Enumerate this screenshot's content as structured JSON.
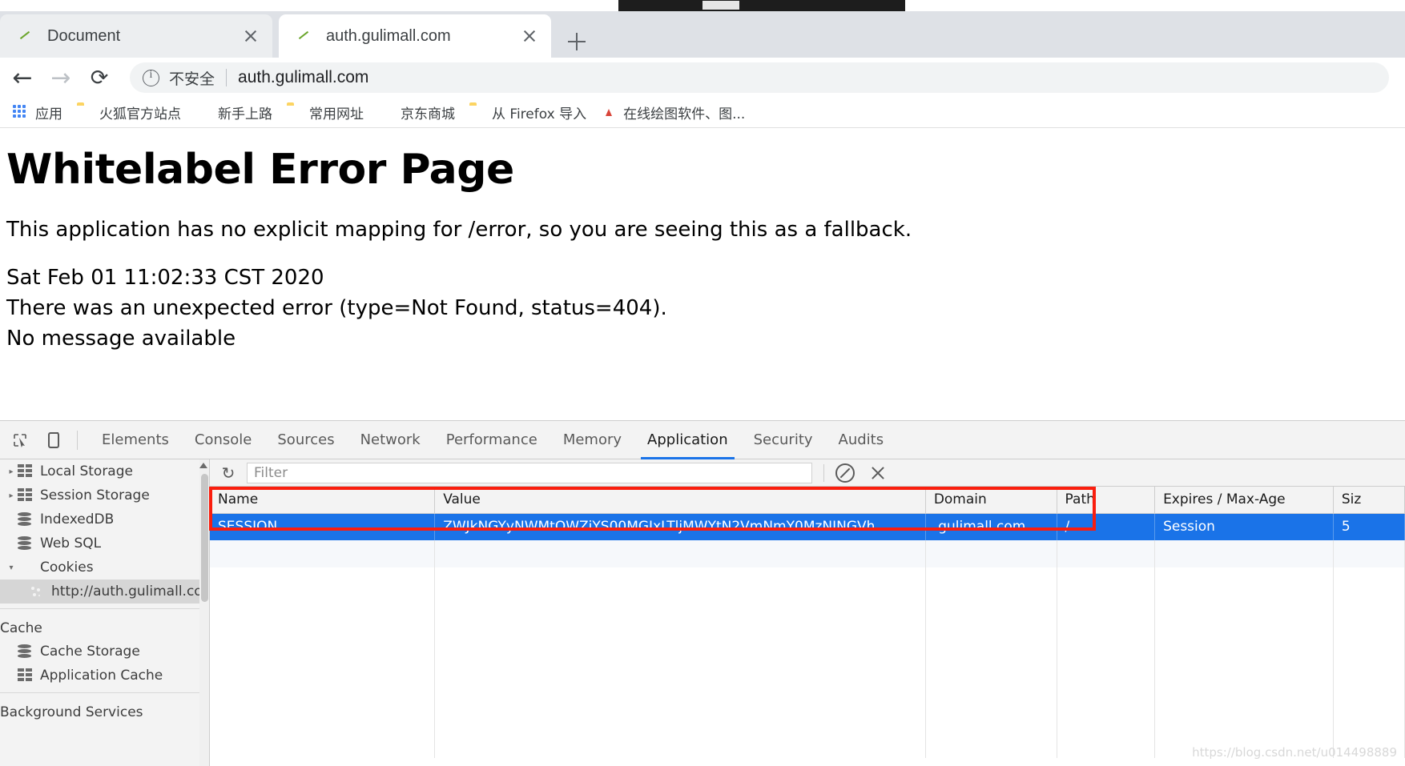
{
  "browser": {
    "tabs": [
      {
        "title": "Document",
        "favicon": "leaf-icon",
        "active": false
      },
      {
        "title": "auth.gulimall.com",
        "favicon": "leaf-icon",
        "active": true
      }
    ],
    "newtab_label": "+",
    "toolbar": {
      "back": "←",
      "forward": "→",
      "reload": "⟳",
      "security_label": "不安全",
      "url": "auth.gulimall.com"
    },
    "bookmarks": [
      {
        "label": "应用",
        "icon": "apps-grid-icon"
      },
      {
        "label": "火狐官方站点",
        "icon": "folder-icon"
      },
      {
        "label": "新手上路",
        "icon": "firefox-icon"
      },
      {
        "label": "常用网址",
        "icon": "folder-icon"
      },
      {
        "label": "京东商城",
        "icon": "globe-icon"
      },
      {
        "label": "从 Firefox 导入",
        "icon": "folder-icon"
      },
      {
        "label": "在线绘图软件、图...",
        "icon": "draw-icon"
      }
    ]
  },
  "page": {
    "heading": "Whitelabel Error Page",
    "paragraph": "This application has no explicit mapping for /error, so you are seeing this as a fallback.",
    "timestamp": "Sat Feb 01 11:02:33 CST 2020",
    "error_line": "There was an unexpected error (type=Not Found, status=404).",
    "message_line": "No message available"
  },
  "devtools": {
    "inspect_icon": "inspect-cursor-icon",
    "device_icon": "device-toolbar-icon",
    "tabs": [
      {
        "label": "Elements",
        "active": false
      },
      {
        "label": "Console",
        "active": false
      },
      {
        "label": "Sources",
        "active": false
      },
      {
        "label": "Network",
        "active": false
      },
      {
        "label": "Performance",
        "active": false
      },
      {
        "label": "Memory",
        "active": false
      },
      {
        "label": "Application",
        "active": true
      },
      {
        "label": "Security",
        "active": false
      },
      {
        "label": "Audits",
        "active": false
      }
    ],
    "sidebar": {
      "items": [
        {
          "label": "Local Storage",
          "icon": "grid-icon",
          "twisty": "▸",
          "indent": 0,
          "selected": false
        },
        {
          "label": "Session Storage",
          "icon": "grid-icon",
          "twisty": "▸",
          "indent": 0,
          "selected": false
        },
        {
          "label": "IndexedDB",
          "icon": "database-icon",
          "twisty": "",
          "indent": 1,
          "selected": false
        },
        {
          "label": "Web SQL",
          "icon": "database-icon",
          "twisty": "",
          "indent": 1,
          "selected": false
        },
        {
          "label": "Cookies",
          "icon": "cookie-icon",
          "twisty": "▾",
          "indent": 0,
          "selected": false
        },
        {
          "label": "http://auth.gulimall.com",
          "icon": "cookie-icon",
          "twisty": "",
          "indent": 2,
          "selected": true
        }
      ],
      "cache_section_title": "Cache",
      "cache_items": [
        {
          "label": "Cache Storage",
          "icon": "database-icon",
          "twisty": "",
          "indent": 1,
          "selected": false
        },
        {
          "label": "Application Cache",
          "icon": "grid-icon",
          "twisty": "",
          "indent": 1,
          "selected": false
        }
      ],
      "background_section_title": "Background Services"
    },
    "filterbar": {
      "refresh_icon": "refresh-icon",
      "filter_placeholder": "Filter",
      "clear_filter_icon": "ban-icon",
      "delete_icon": "close-x-icon"
    },
    "cookie_table": {
      "columns": [
        "Name",
        "Value",
        "Domain",
        "Path",
        "Expires / Max-Age",
        "Siz"
      ],
      "rows": [
        {
          "name": "SESSION",
          "value": "ZWJkNGYyNWMtOWZiYS00MGIxLTljMWYtN2VmNmY0MzNINGVh",
          "domain": ".gulimall.com",
          "path": "/",
          "expires": "Session",
          "size": "5"
        }
      ]
    }
  },
  "annotation": {
    "highlight_color": "#fa1e0e"
  },
  "watermark": "https://blog.csdn.net/u014498889"
}
